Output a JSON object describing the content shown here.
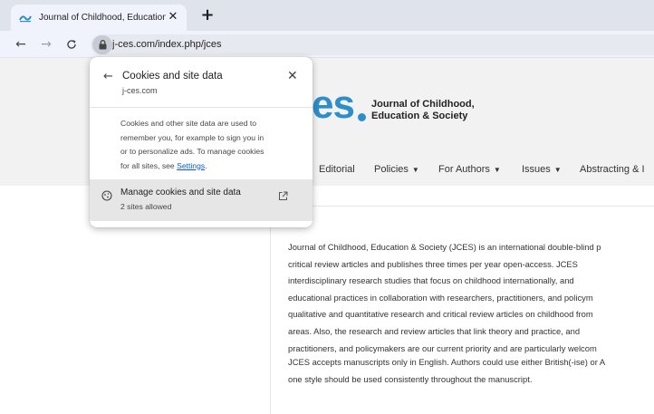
{
  "browser": {
    "tab": {
      "title": "Journal of Childhood, Education",
      "favicon": "journal-favicon-icon"
    },
    "toolbar": {
      "url": "j-ces.com/index.php/jces"
    }
  },
  "page": {
    "logo": {
      "mark": "es",
      "line1": "Journal of Childhood,",
      "line2": "Education & Society"
    },
    "nav": [
      {
        "label": "Editorial",
        "has_caret": false
      },
      {
        "label": "Policies",
        "has_caret": true
      },
      {
        "label": "For Authors",
        "has_caret": true
      },
      {
        "label": "Issues",
        "has_caret": true
      },
      {
        "label": "Abstracting & I",
        "has_caret": false
      }
    ],
    "paragraph1": [
      "Journal of Childhood, Education & Society (JCES) is an international double-blind p",
      "critical review articles and publishes three times per year open-access. JCES",
      "interdisciplinary research studies that focus on childhood internationally, and",
      "educational practices in collaboration with researchers, practitioners, and policym",
      "qualitative and quantitative research and critical review articles on childhood from",
      "areas. Also, the research and review articles that link theory and practice, and",
      "practitioners, and policymakers are our current priority and are particularly welcom"
    ],
    "paragraph2": [
      "JCES accepts manuscripts only in English. Authors could use either British(-ise) or A",
      "one style should be used consistently throughout the manuscript."
    ]
  },
  "popup": {
    "title": "Cookies and site data",
    "subtitle": "j-ces.com",
    "description_lines": [
      "Cookies and other site data are used to",
      "remember you, for example to sign you in",
      "or to personalize ads. To manage cookies"
    ],
    "description_last_prefix": "for all sites, see ",
    "settings_link": "Settings",
    "description_last_suffix": ".",
    "manage": {
      "label": "Manage cookies and site data",
      "sub": "2 sites allowed"
    }
  },
  "colors": {
    "brand": "#2e8ec7",
    "link": "#0b57d0"
  }
}
